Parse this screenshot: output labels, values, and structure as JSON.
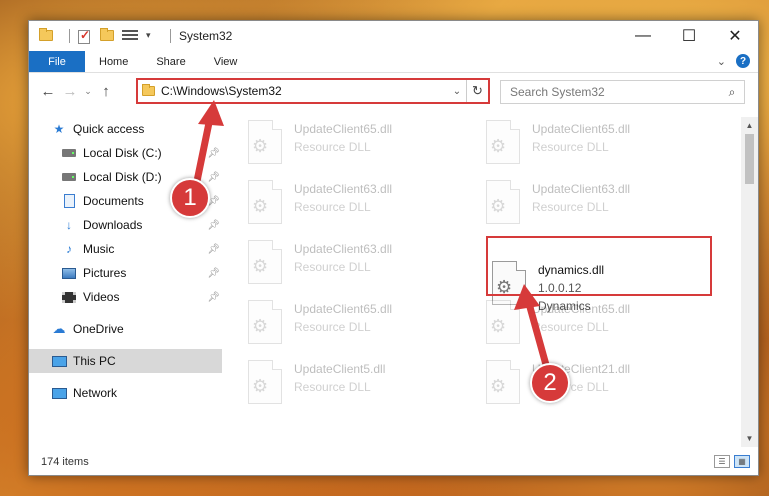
{
  "window": {
    "title": "System32",
    "controls": {
      "minimize": "—",
      "maximize": "☐",
      "close": "✕"
    }
  },
  "ribbon": {
    "tabs": [
      "File",
      "Home",
      "Share",
      "View"
    ]
  },
  "nav": {
    "back": "←",
    "forward": "→",
    "recent": "⌄",
    "up": "↑",
    "address": "C:\\Windows\\System32",
    "address_dropdown": "⌄",
    "refresh": "↻"
  },
  "search": {
    "placeholder": "Search System32"
  },
  "sidebar": {
    "items": [
      {
        "label": "Quick access",
        "icon": "star-icon"
      },
      {
        "label": "Local Disk (C:)",
        "icon": "disk-icon",
        "pinned": true
      },
      {
        "label": "Local Disk (D:)",
        "icon": "disk-icon",
        "pinned": true
      },
      {
        "label": "Documents",
        "icon": "documents-icon",
        "pinned": true
      },
      {
        "label": "Downloads",
        "icon": "download-icon",
        "pinned": true
      },
      {
        "label": "Music",
        "icon": "music-icon",
        "pinned": true
      },
      {
        "label": "Pictures",
        "icon": "pictures-icon",
        "pinned": true
      },
      {
        "label": "Videos",
        "icon": "videos-icon",
        "pinned": true
      },
      {
        "label": "OneDrive",
        "icon": "cloud-icon"
      },
      {
        "label": "This PC",
        "icon": "computer-icon",
        "selected": true
      },
      {
        "label": "Network",
        "icon": "network-icon"
      }
    ]
  },
  "files": [
    {
      "name": "UpdateClient65.dll",
      "sub1": "Resource DLL",
      "ghost": true
    },
    {
      "name": "UpdateClient65.dll",
      "sub1": "Resource DLL",
      "ghost": true
    },
    {
      "name": "UpdateClient63.dll",
      "sub1": "Resource DLL",
      "ghost": true
    },
    {
      "name": "UpdateClient63.dll",
      "sub1": "Resource DLL",
      "ghost": true
    },
    {
      "name": "UpdateClient63.dll",
      "sub1": "Resource DLL",
      "ghost": true
    },
    {
      "name": "dynamics.dll",
      "sub1": "1.0.0.12",
      "sub2": "Dynamics",
      "ghost": false
    },
    {
      "name": "UpdateClient65.dll",
      "sub1": "Resource DLL",
      "ghost": true
    },
    {
      "name": "UpdateClient65.dll",
      "sub1": "Resource DLL",
      "ghost": true
    },
    {
      "name": "UpdateClient5.dll",
      "sub1": "Resource DLL",
      "ghost": true
    },
    {
      "name": "UpdateClient21.dll",
      "sub1": "Resource DLL",
      "ghost": true
    }
  ],
  "status": {
    "item_count": "174 items"
  },
  "markers": [
    "1",
    "2"
  ],
  "colors": {
    "accent": "#1a6fc4",
    "annotation": "#d63a3a"
  }
}
